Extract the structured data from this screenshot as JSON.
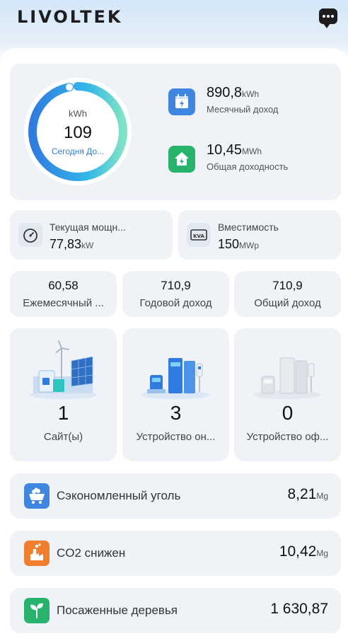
{
  "header": {
    "logo": "LIVOLTEK",
    "chat_icon": "chat-icon"
  },
  "today": {
    "unit": "kWh",
    "value": "109",
    "label": "Сегодня До...",
    "progress_fraction": 0.97,
    "monthly": {
      "value": "890,8",
      "unit": "kWh",
      "label": "Месячный доход",
      "icon": "calendar-bolt-icon",
      "color": "#3f86e0"
    },
    "total": {
      "value": "10,45",
      "unit": "MWh",
      "label": "Общая доходность",
      "icon": "home-bolt-icon",
      "color": "#27b36b"
    }
  },
  "power": {
    "label": "Текущая мощн...",
    "value": "77,83",
    "unit": "kW",
    "icon": "gauge-icon"
  },
  "capacity": {
    "label": "Вместимость",
    "value": "150",
    "unit": "MWp",
    "icon": "kva-icon",
    "icon_text": "KVA"
  },
  "income": [
    {
      "value": "60,58",
      "label": "Ежемесячный ..."
    },
    {
      "value": "710,9",
      "label": "Годовой доход"
    },
    {
      "value": "710,9",
      "label": "Общий доход"
    }
  ],
  "devices": [
    {
      "count": "1",
      "label": "Сайт(ы)",
      "icon": "solar-site-icon"
    },
    {
      "count": "3",
      "label": "Устройство он...",
      "icon": "online-device-icon"
    },
    {
      "count": "0",
      "label": "Устройство оф...",
      "icon": "offline-device-icon"
    }
  ],
  "environment": [
    {
      "label": "Сэкономленный уголь",
      "value": "8,21",
      "unit": "Mg",
      "icon": "coal-cart-icon",
      "color": "#3f86e0"
    },
    {
      "label": "CO2 снижен",
      "value": "10,42",
      "unit": "Mg",
      "icon": "factory-icon",
      "color": "#ef7e2e"
    },
    {
      "label": "Посаженные деревья",
      "value": "1 630,87",
      "unit": "",
      "icon": "sprout-icon",
      "color": "#27b36b"
    }
  ]
}
